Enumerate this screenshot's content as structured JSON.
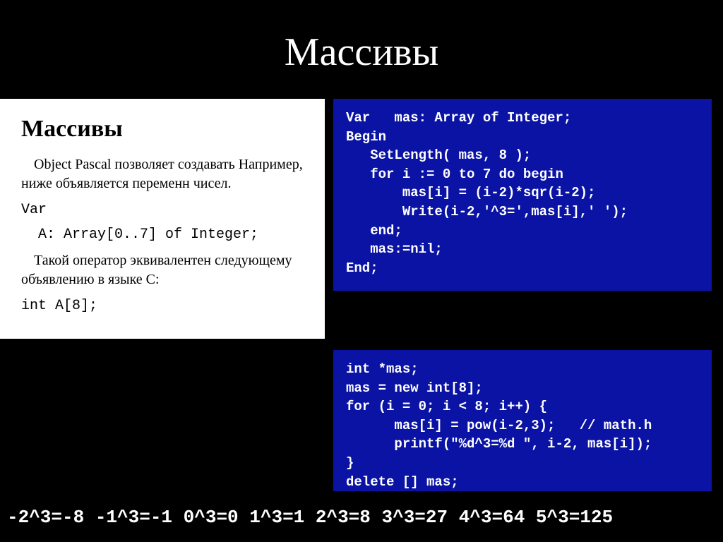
{
  "slide": {
    "title": "Массивы"
  },
  "doc": {
    "heading": "Массивы",
    "p1": "Object Pascal позволяет создавать Например, ниже объявляется переменн чисел.",
    "code1_line1": "Var",
    "code1_line2": "  A: Array[0..7] of Integer;",
    "p2": "Такой оператор эквивалентен следующему объявлению в языке C:",
    "code2": "int A[8];"
  },
  "pascal_code": "Var   mas: Array of Integer;\nBegin\n   SetLength( mas, 8 );\n   for i := 0 to 7 do begin\n       mas[i] = (i-2)*sqr(i-2);\n       Write(i-2,'^3=',mas[i],' ');\n   end;\n   mas:=nil;\nEnd;",
  "c_code": "int *mas;\nmas = new int[8];\nfor (i = 0; i < 8; i++) {\n      mas[i] = pow(i-2,3);   // math.h\n      printf(\"%d^3=%d \", i-2, mas[i]);\n}\ndelete [] mas;",
  "output": "-2^3=-8 -1^3=-1 0^3=0 1^3=1 2^3=8 3^3=27 4^3=64 5^3=125"
}
